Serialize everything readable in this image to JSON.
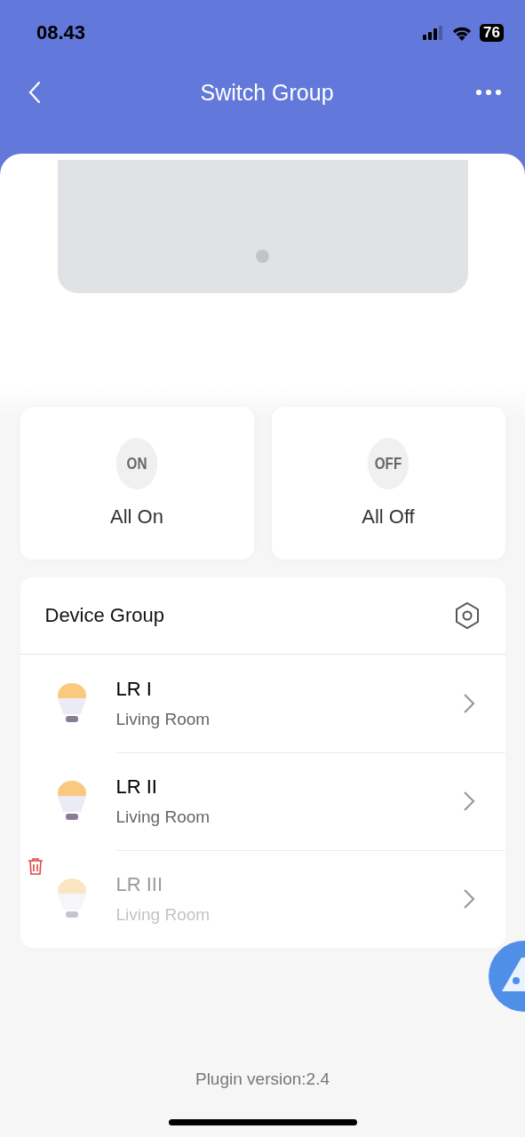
{
  "status_bar": {
    "time": "08.43",
    "battery": "76"
  },
  "header": {
    "title": "Switch Group"
  },
  "actions": [
    {
      "badge": "ON",
      "label": "All On"
    },
    {
      "badge": "OFF",
      "label": "All Off"
    }
  ],
  "device_group": {
    "title": "Device Group",
    "devices": [
      {
        "name": "LR I",
        "room": "Living Room",
        "disabled": false
      },
      {
        "name": "LR II",
        "room": "Living Room",
        "disabled": false
      },
      {
        "name": "LR III",
        "room": "Living Room",
        "disabled": true
      }
    ]
  },
  "footer": {
    "version": "Plugin version:2.4"
  }
}
